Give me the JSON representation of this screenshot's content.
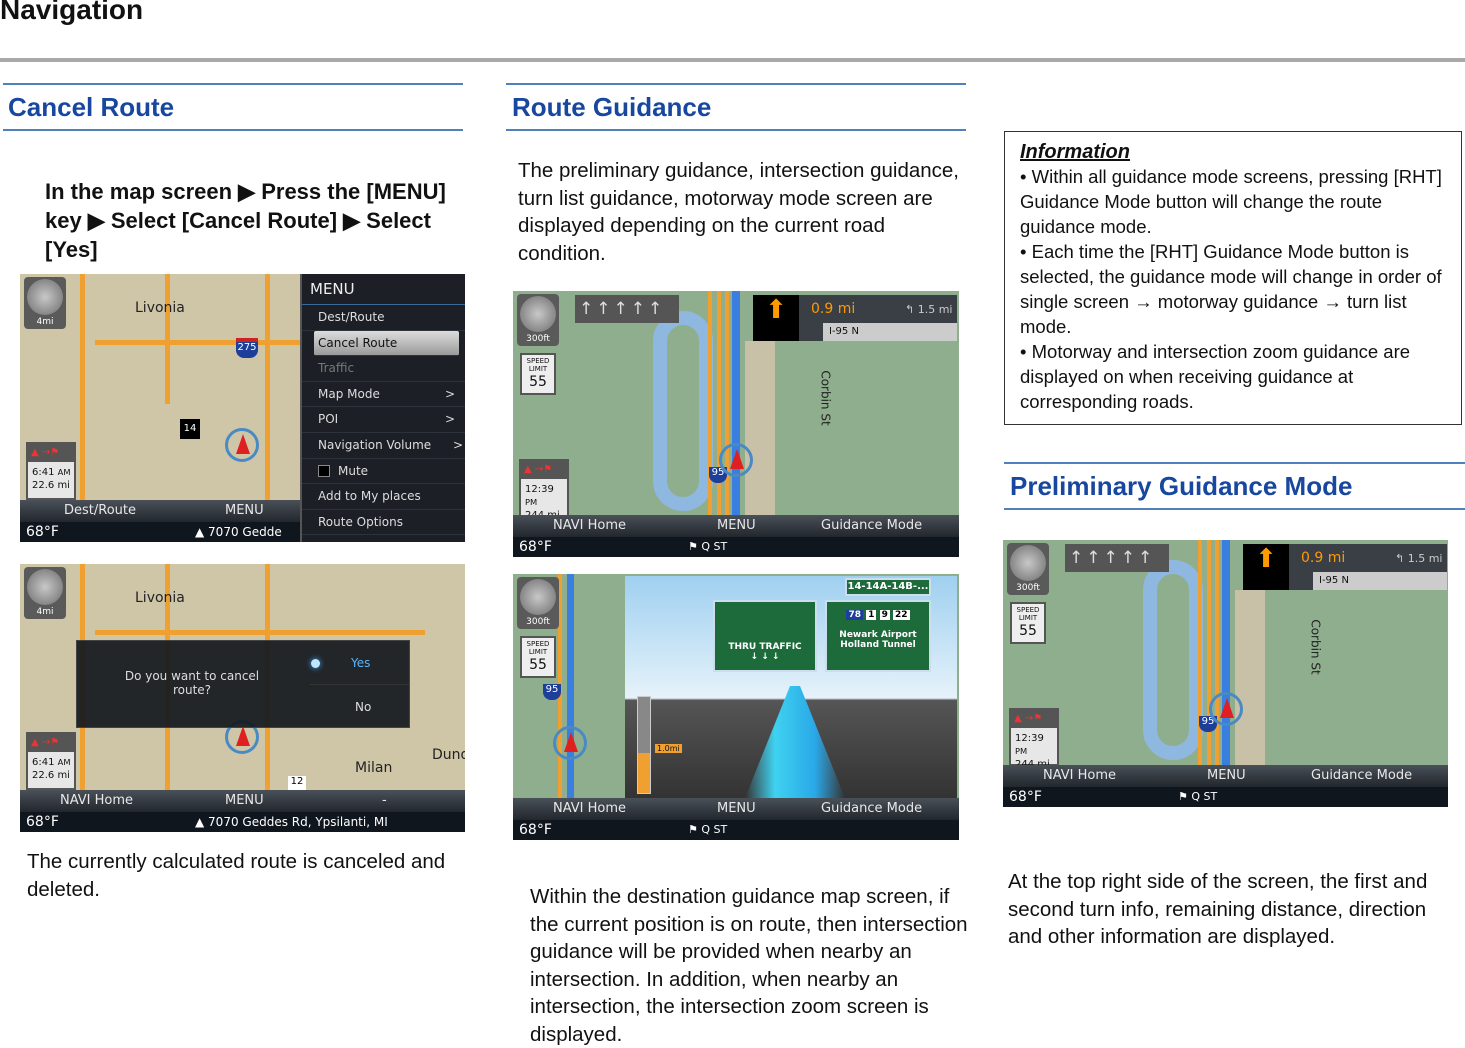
{
  "page_title": "Navigation",
  "colors": {
    "heading": "#17479e",
    "rule": "#4f81bd"
  },
  "cancel_route": {
    "title": "Cancel Route",
    "instruction": "In the map screen ▶ Press the [MENU] key ▶ Select [Cancel Route] ▶ Select [Yes]",
    "caption": "The currently calculated route is canceled and deleted.",
    "screen1": {
      "scale": "4mi",
      "city": "Livonia",
      "interstate": "275",
      "route": "14",
      "eta_time": "6:41",
      "eta_ampm": "AM",
      "eta_dist": "22.6 mi",
      "soft_left": "Dest/Route",
      "soft_mid": "MENU",
      "temp": "68°F",
      "address": "7070 Gedde",
      "menu": {
        "title": "MENU",
        "items": [
          {
            "label": "Dest/Route"
          },
          {
            "label": "Cancel Route",
            "selected": true
          },
          {
            "label": "Traffic",
            "disabled": true
          },
          {
            "label": "Map Mode",
            "arrow": ">"
          },
          {
            "label": "POI",
            "arrow": ">"
          },
          {
            "label": "Navigation Volume",
            "arrow": ">"
          },
          {
            "label": "Mute",
            "checkbox": true
          },
          {
            "label": "Add to My places"
          },
          {
            "label": "Route Options"
          }
        ]
      }
    },
    "screen2": {
      "scale": "4mi",
      "city": "Livonia",
      "city2": "Milan",
      "city3": "Dund",
      "route": "12",
      "dialog_text": "Do you want to cancel route?",
      "yes": "Yes",
      "no": "No",
      "eta_time": "6:41",
      "eta_ampm": "AM",
      "eta_dist": "22.6 mi",
      "soft_left": "NAVI Home",
      "soft_mid": "MENU",
      "soft_right": "-",
      "temp": "68°F",
      "address": "7070 Geddes Rd, Ypsilanti, MI"
    }
  },
  "route_guidance": {
    "title": "Route Guidance",
    "intro": "The preliminary guidance, intersection guidance, turn list guidance, motorway mode screen are displayed depending on the current road condition.",
    "body": "Within the destination guidance map screen, if the current position is on route, then intersection guidance will be provided when nearby an intersection. In addition, when nearby an intersection, the intersection zoom screen is displayed.",
    "screen3": {
      "scale": "300ft",
      "speed_label": "SPEED LIMIT",
      "speed": "55",
      "dist1": "0.9 mi",
      "dist2": "1.5 mi",
      "road": "I-95 N",
      "street": "Corbin St",
      "interstate": "95",
      "eta_time": "12:39",
      "eta_ampm": "PM",
      "eta_dist": "244 mi",
      "soft_left": "NAVI Home",
      "soft_mid": "MENU",
      "soft_right": "Guidance Mode",
      "temp": "68°F",
      "dest": "Q ST"
    },
    "screen4": {
      "scale": "300ft",
      "speed_label": "SPEED LIMIT",
      "speed": "55",
      "interstate": "95",
      "exit": "14-14A-14B-...",
      "sign_left": "THRU TRAFFIC",
      "shields": [
        "78",
        "1",
        "9",
        "22"
      ],
      "sign_right_1": "Newark Airport",
      "sign_right_2": "Holland Tunnel",
      "bar_dist": "1.0mi",
      "soft_left": "NAVI Home",
      "soft_mid": "MENU",
      "soft_right": "Guidance Mode",
      "temp": "68°F",
      "dest": "Q ST"
    }
  },
  "information": {
    "title": "Information",
    "bullets": [
      "• Within all guidance mode screens, pressing [RHT] Guidance Mode button will change the route guidance mode.",
      "• Each time the [RHT] Guidance Mode button is selected, the guidance mode will change in order of single screen → motorway guidance → turn list mode.",
      "• Motorway and intersection zoom guidance are displayed on when receiving guidance at corresponding roads."
    ]
  },
  "preliminary": {
    "title": "Preliminary Guidance Mode",
    "body": "At the top right side of the screen, the first and second turn info, remaining distance, direction and other information are displayed.",
    "screen5": {
      "scale": "300ft",
      "speed_label": "SPEED LIMIT",
      "speed": "55",
      "dist1": "0.9 mi",
      "dist2": "1.5 mi",
      "road": "I-95 N",
      "street": "Corbin St",
      "interstate": "95",
      "eta_time": "12:39",
      "eta_ampm": "PM",
      "eta_dist": "244 mi",
      "soft_left": "NAVI Home",
      "soft_mid": "MENU",
      "soft_right": "Guidance Mode",
      "temp": "68°F",
      "dest": "Q ST"
    }
  }
}
